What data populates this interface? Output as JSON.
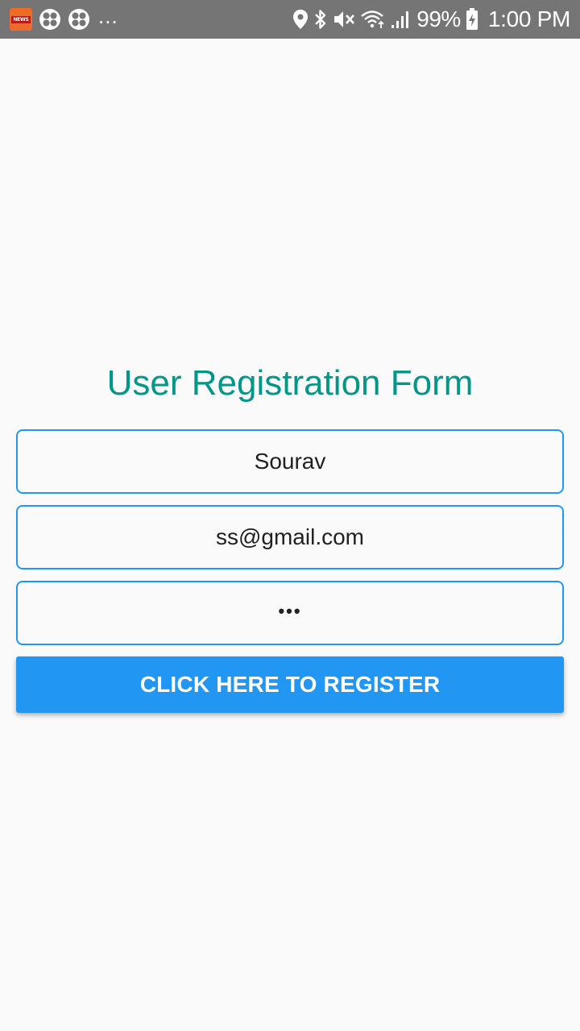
{
  "status_bar": {
    "app_icon": "news-app-icon",
    "app_icon_text": "NEWS",
    "overflow_text": "...",
    "battery_percent": "99%",
    "time": "1:00 PM",
    "icons": [
      "location-icon",
      "bluetooth-icon",
      "mute-icon",
      "wifi-icon",
      "signal-icon",
      "battery-charging-icon"
    ]
  },
  "form": {
    "title": "User Registration Form",
    "name_value": "Sourav",
    "email_value": "ss@gmail.com",
    "password_value": "•••",
    "register_label": "CLICK HERE TO REGISTER"
  },
  "colors": {
    "status_bar_bg": "#757575",
    "title": "#009688",
    "field_border": "#2196f3",
    "button_bg": "#2196f3",
    "page_bg": "#fafafa"
  }
}
